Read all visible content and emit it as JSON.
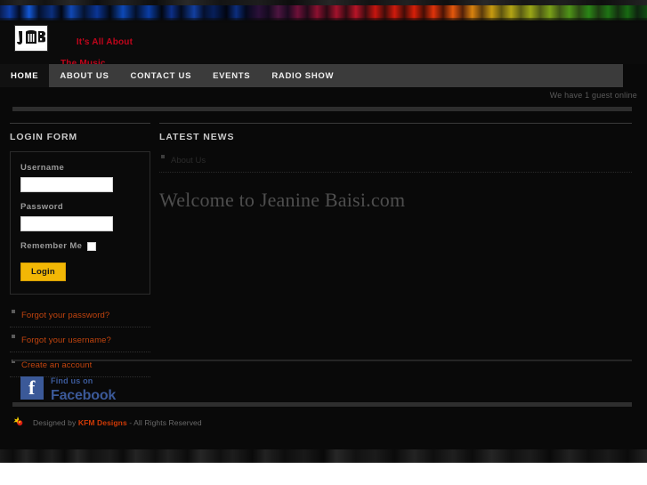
{
  "site": {
    "logo_text": "JB",
    "logo_icon": "music-logo-icon",
    "tagline_line1": "It's All About",
    "tagline_line2": "The Music"
  },
  "nav": {
    "items": [
      {
        "label": "HOME",
        "active": true
      },
      {
        "label": "ABOUT US",
        "active": false
      },
      {
        "label": "CONTACT US",
        "active": false
      },
      {
        "label": "EVENTS",
        "active": false
      },
      {
        "label": "RADIO SHOW",
        "active": false
      }
    ]
  },
  "status": {
    "guest_text": "We have 1 guest online"
  },
  "sidebar": {
    "login_form": {
      "title": "LOGIN FORM",
      "username_label": "Username",
      "username_value": "",
      "username_placeholder": "",
      "password_label": "Password",
      "password_value": "",
      "password_placeholder": "",
      "remember_label": "Remember Me",
      "remember_checked": false,
      "submit_label": "Login"
    },
    "links": [
      {
        "label": "Forgot your password?"
      },
      {
        "label": "Forgot your username?"
      },
      {
        "label": "Create an account"
      }
    ]
  },
  "content": {
    "module_title": "LATEST NEWS",
    "news_items": [
      {
        "label": "About Us"
      }
    ],
    "page_heading": "Welcome to Jeanine Baisi.com"
  },
  "social": {
    "facebook_line1": "Find us on",
    "facebook_line2": "Facebook",
    "facebook_icon": "facebook-f-icon"
  },
  "footer": {
    "prefix": "Designed by ",
    "brand": "KFM Designs",
    "suffix": " - All Rights Reserved",
    "mark_icon": "kfm-logo-icon"
  },
  "colors": {
    "accent_red": "#c0051b",
    "link_orange": "#c1440e",
    "button_yellow": "#f2b705",
    "facebook_blue": "#3b5998",
    "page_bg": "#090909",
    "nav_bg": "#3b3b3b"
  }
}
